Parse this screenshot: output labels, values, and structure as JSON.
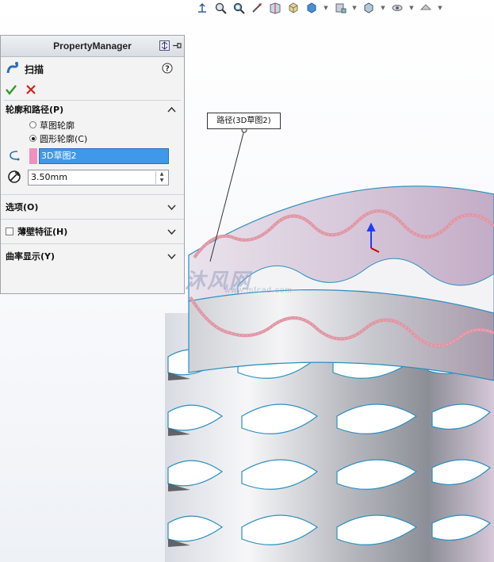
{
  "toolbar": {
    "icons": [
      "view-orientation-icon",
      "zoom-to-fit-icon",
      "zoom-area-icon",
      "previous-view-icon",
      "section-view-icon",
      "view-orientation-cube-icon",
      "display-style-icon",
      "hide-show-items-icon",
      "edit-appearance-icon",
      "apply-scene-icon"
    ]
  },
  "property_manager": {
    "title": "PropertyManager",
    "feature_title": "扫描",
    "sections": {
      "profile_path": {
        "label": "轮廓和路径(P)",
        "option_sketch": "草图轮廓",
        "option_circular": "圆形轮廓(C)",
        "selected_option": "圆形轮廓(C)",
        "path_selection": "3D草图2",
        "diameter_value": "3.50mm"
      },
      "options": {
        "label": "选项(O)"
      },
      "thin_feature": {
        "label": "薄壁特征(H)",
        "checked": false
      },
      "curvature_display": {
        "label": "曲率显示(Y)"
      }
    }
  },
  "graphics": {
    "callout_label": "路径(3D草图2)",
    "watermark_text": "沐风网",
    "watermark_url": "www.mfcad.com",
    "colors": {
      "surface_edge": "#2b8fc0",
      "inner_wall": "#c9b4c9",
      "path_pink": "#e98fb0",
      "path_green": "#b7d27a"
    }
  }
}
